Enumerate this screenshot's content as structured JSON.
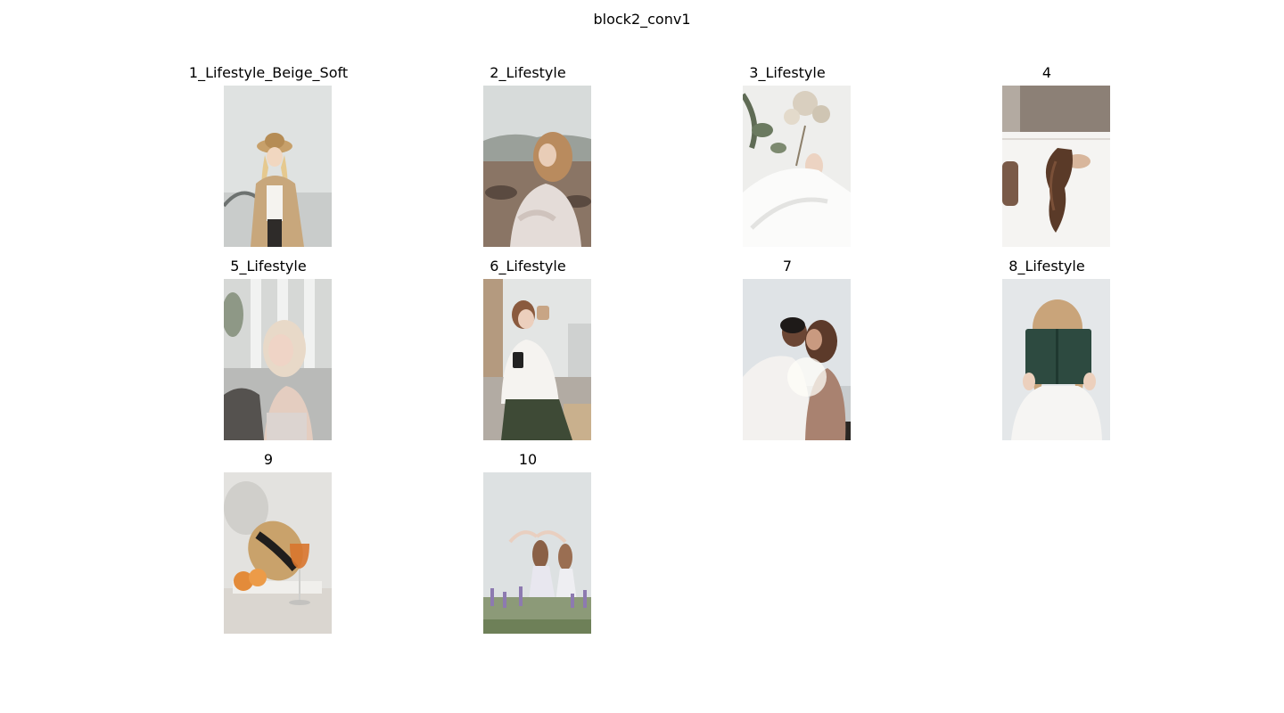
{
  "figure": {
    "title": "block2_conv1"
  },
  "images": [
    {
      "label": "1_Lifestyle_Beige_Soft",
      "alt": "woman in tan coat and hat"
    },
    {
      "label": "2_Lifestyle",
      "alt": "woman with windswept hair outdoors"
    },
    {
      "label": "3_Lifestyle",
      "alt": "hand holding dried flowers"
    },
    {
      "label": "4",
      "alt": "woman with curly hair leaning back"
    },
    {
      "label": "5_Lifestyle",
      "alt": "blonde woman sitting"
    },
    {
      "label": "6_Lifestyle",
      "alt": "woman drinking coffee with phone"
    },
    {
      "label": "7",
      "alt": "couple embracing"
    },
    {
      "label": "8_Lifestyle",
      "alt": "woman holding green book"
    },
    {
      "label": "9",
      "alt": "straw hat, peaches and glass"
    },
    {
      "label": "10",
      "alt": "two women in lavender field"
    }
  ]
}
